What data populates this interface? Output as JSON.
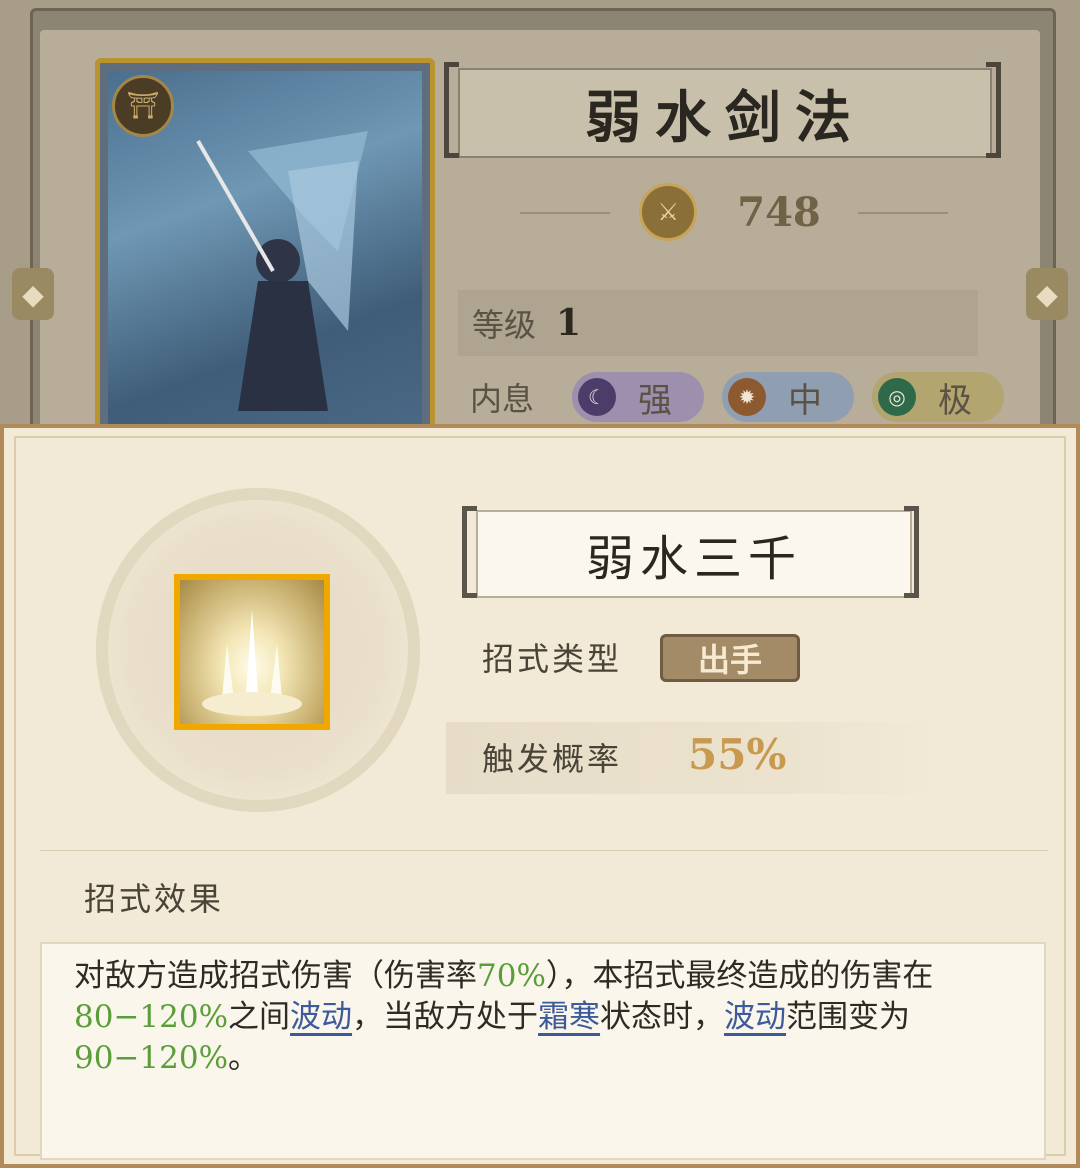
{
  "background_card": {
    "skill_title": "弱水剑法",
    "power": "748",
    "level_label": "等级",
    "level_value": "1",
    "neixi_label": "内息",
    "neixi": [
      {
        "label": "强",
        "icon": "moon-icon"
      },
      {
        "label": "中",
        "icon": "sun-icon"
      },
      {
        "label": "极",
        "icon": "jade-ring-icon"
      }
    ]
  },
  "popup": {
    "skill_name": "弱水三千",
    "type_label": "招式类型",
    "type_value": "出手",
    "rate_label": "触发概率",
    "rate_value": "55%",
    "effect_title": "招式效果",
    "effect": {
      "p1": "对敌方造成招式伤害（伤害率",
      "g1": "70%",
      "p2": "），本招式最终造成的伤害在",
      "g2": "80−120%",
      "p3": "之间",
      "link1": "波动",
      "p4": "，当敌方处于",
      "link2": "霜寒",
      "p5": "状态时，",
      "link3": "波动",
      "p6": "范围变为",
      "g3": "90−120%",
      "p7": "。"
    }
  },
  "colors": {
    "highlight_green": "#5a9e3a",
    "link_blue": "#3d5a9a",
    "rate_gold": "#c89a4f",
    "icon_frame": "#f0a800"
  }
}
